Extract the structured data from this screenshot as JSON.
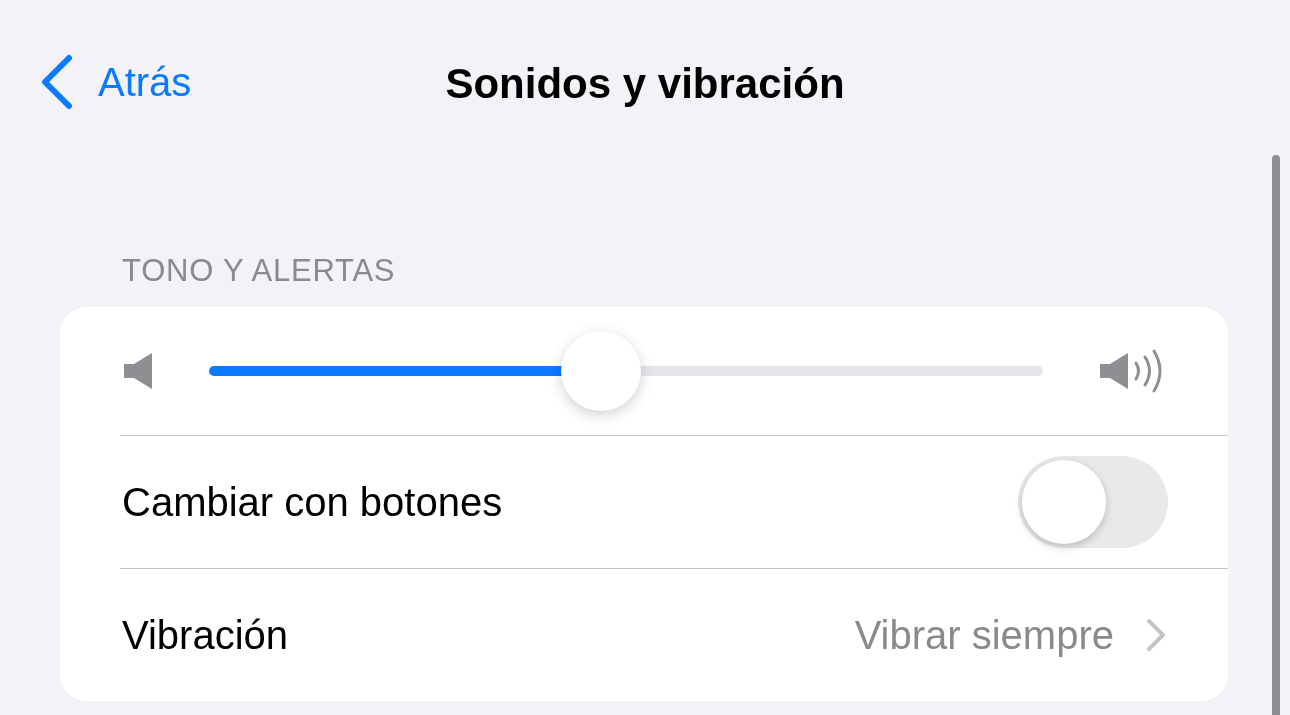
{
  "nav": {
    "back": "Atrás",
    "title": "Sonidos y vibración"
  },
  "section": {
    "header": "TONO Y ALERTAS",
    "rows": [
      {
        "kind": "slider",
        "level": 0.47
      },
      {
        "kind": "toggle",
        "label": "Cambiar con botones",
        "on": false
      },
      {
        "kind": "link",
        "label": "Vibración",
        "value": "Vibrar siempre"
      }
    ]
  }
}
